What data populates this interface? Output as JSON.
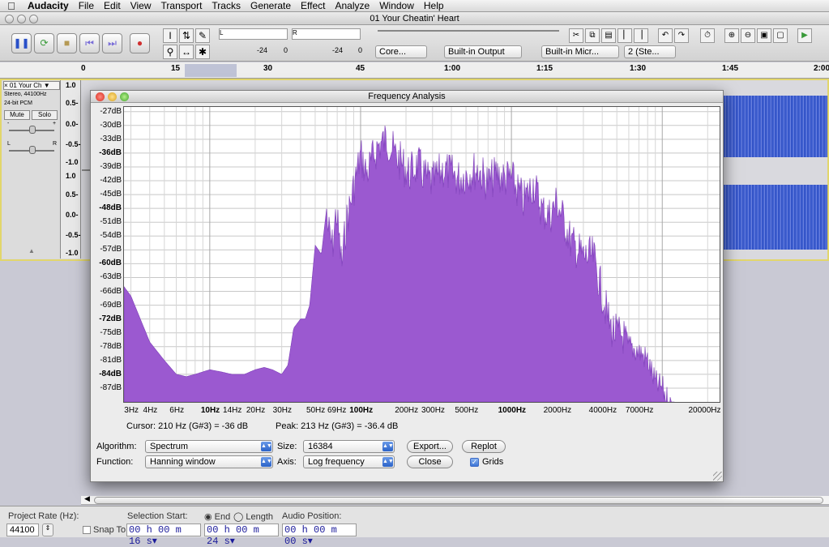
{
  "menubar": {
    "app": "Audacity",
    "items": [
      "File",
      "Edit",
      "View",
      "Transport",
      "Tracks",
      "Generate",
      "Effect",
      "Analyze",
      "Window",
      "Help"
    ]
  },
  "window": {
    "title": "01 Your Cheatin' Heart"
  },
  "meters": {
    "out_marks": [
      "-24",
      "0"
    ],
    "in_marks": [
      "-24",
      "0"
    ],
    "L": "L",
    "R": "R"
  },
  "device_bar": {
    "host": "Core...",
    "output": "Built-in Output",
    "input": "Built-in Micr...",
    "channels": "2 (Ste..."
  },
  "ruler": {
    "ticks": [
      "0",
      "15",
      "30",
      "45",
      "1:00",
      "1:15",
      "1:30",
      "1:45",
      "2:00"
    ]
  },
  "track": {
    "name": "01 Your Ch",
    "info1": "Stereo, 44100Hz",
    "info2": "24-bit PCM",
    "mute": "Mute",
    "solo": "Solo",
    "pan_l": "L",
    "pan_r": "R",
    "gain_minus": "-",
    "gain_plus": "+",
    "scale": [
      "1.0",
      "0.5-",
      "0.0-",
      "-0.5-",
      "-1.0",
      "1.0",
      "0.5-",
      "0.0-",
      "-0.5-",
      "-1.0"
    ]
  },
  "dialog": {
    "title": "Frequency Analysis",
    "cursor_text": "Cursor: 210 Hz (G#3) = -36 dB",
    "peak_text": "Peak: 213 Hz (G#3) = -36.4 dB",
    "algorithm_label": "Algorithm:",
    "algorithm_value": "Spectrum",
    "size_label": "Size:",
    "size_value": "16384",
    "function_label": "Function:",
    "function_value": "Hanning window",
    "axis_label": "Axis:",
    "axis_value": "Log frequency",
    "export_button": "Export...",
    "replot_button": "Replot",
    "close_button": "Close",
    "grids_label": "Grids",
    "grids_checked": true
  },
  "chart_data": {
    "type": "area",
    "color": "#9b59d0",
    "xscale": "log",
    "xlim": [
      2.7,
      24000
    ],
    "ylim": [
      -90,
      -26
    ],
    "y_ticks": [
      "-27dB",
      "-30dB",
      "-33dB",
      "-36dB",
      "-39dB",
      "-42dB",
      "-45dB",
      "-48dB",
      "-51dB",
      "-54dB",
      "-57dB",
      "-60dB",
      "-63dB",
      "-66dB",
      "-69dB",
      "-72dB",
      "-75dB",
      "-78dB",
      "-81dB",
      "-84dB",
      "-87dB"
    ],
    "x_ticks": [
      "3Hz",
      "4Hz",
      "6Hz",
      "10Hz",
      "14Hz",
      "20Hz",
      "30Hz",
      "50Hz",
      "69Hz",
      "100Hz",
      "200Hz",
      "300Hz",
      "500Hz",
      "1000Hz",
      "2000Hz",
      "4000Hz",
      "7000Hz",
      "20000Hz"
    ],
    "x_tick_values": [
      3,
      4,
      6,
      10,
      14,
      20,
      30,
      50,
      69,
      100,
      200,
      300,
      500,
      1000,
      2000,
      4000,
      7000,
      20000
    ],
    "x": [
      2.7,
      3,
      4,
      5,
      6,
      7,
      8,
      10,
      12,
      14,
      17,
      20,
      23,
      26,
      30,
      33,
      36,
      40,
      43,
      46,
      50,
      55,
      60,
      65,
      69,
      75,
      80,
      90,
      100,
      110,
      130,
      150,
      170,
      190,
      210,
      240,
      270,
      300,
      350,
      400,
      450,
      500,
      600,
      700,
      800,
      900,
      1000,
      1200,
      1400,
      1600,
      1800,
      2000,
      2500,
      3000,
      3500,
      4000,
      4500,
      5000,
      5500,
      6000,
      7000,
      8000,
      9000,
      10000,
      11000,
      12000
    ],
    "y": [
      -65,
      -67,
      -77,
      -81,
      -84,
      -84.5,
      -84,
      -83,
      -83.5,
      -84,
      -84,
      -83,
      -82.5,
      -83,
      -84,
      -82,
      -74,
      -72,
      -72,
      -69,
      -56,
      -58,
      -47,
      -52,
      -44,
      -56,
      -47,
      -39,
      -32,
      -36,
      -30,
      -28.5,
      -32,
      -34,
      -36,
      -34,
      -37,
      -38,
      -35,
      -36,
      -37,
      -36,
      -35,
      -38,
      -36,
      -37,
      -37,
      -42,
      -38,
      -44,
      -45,
      -42,
      -51,
      -54,
      -54,
      -62,
      -69,
      -71,
      -71,
      -75,
      -76,
      -78,
      -83,
      -84,
      -87,
      -89
    ]
  }
}
